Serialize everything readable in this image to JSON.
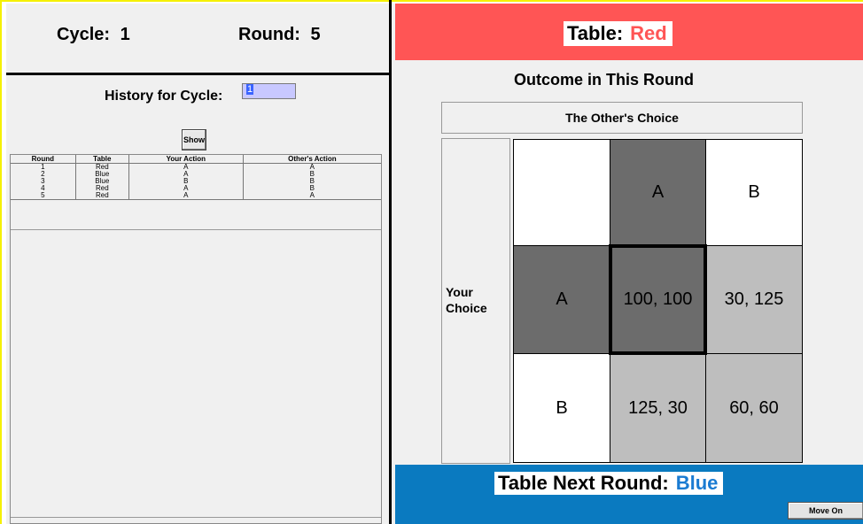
{
  "header": {
    "cycle_label": "Cycle:",
    "cycle_value": "1",
    "round_label": "Round:",
    "round_value": "5"
  },
  "history": {
    "title": "History for Cycle:",
    "cycle_input_value": "1",
    "show_button": "Show",
    "columns": [
      "Round",
      "Table",
      "Your Action",
      "Other's Action"
    ],
    "rows": [
      [
        "1",
        "Red",
        "A",
        "A"
      ],
      [
        "2",
        "Blue",
        "A",
        "B"
      ],
      [
        "3",
        "Blue",
        "B",
        "B"
      ],
      [
        "4",
        "Red",
        "A",
        "B"
      ],
      [
        "5",
        "Red",
        "A",
        "A"
      ]
    ]
  },
  "table": {
    "label": "Table:",
    "value": "Red",
    "banner_color": "#ff5555"
  },
  "outcome": {
    "title": "Outcome in This Round",
    "others_choice_label": "The Other's Choice",
    "your_choice_label_line1": "Your",
    "your_choice_label_line2": "Choice",
    "col_headers": [
      "A",
      "B"
    ],
    "row_headers": [
      "A",
      "B"
    ],
    "payoffs": [
      [
        "100, 100",
        "30, 125"
      ],
      [
        "125, 30",
        "60, 60"
      ]
    ]
  },
  "next_round": {
    "label": "Table Next Round:",
    "value": "Blue",
    "banner_color": "#0a7ac0"
  },
  "move_on_button": "Move On"
}
